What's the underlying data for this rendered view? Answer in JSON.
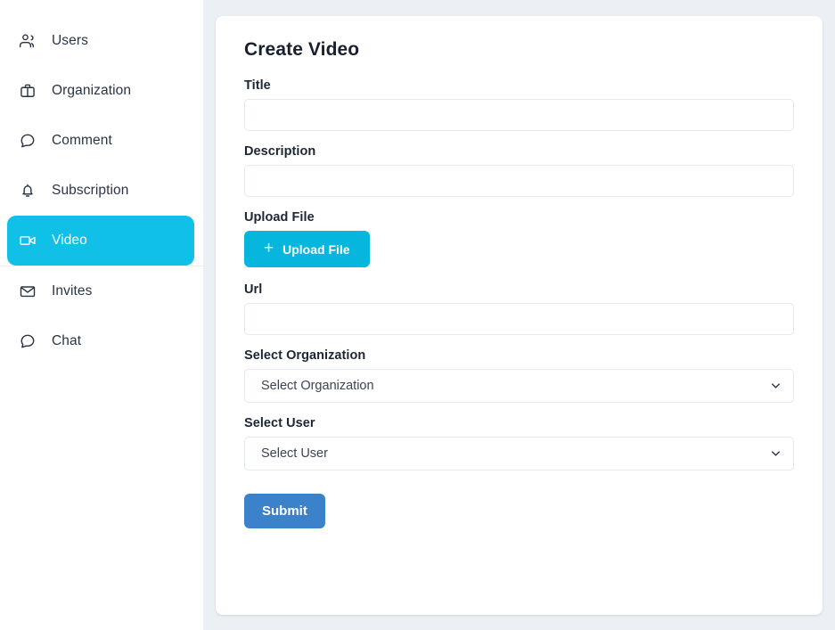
{
  "sidebar": {
    "items": [
      {
        "label": "Users",
        "icon": "users-icon",
        "active": false
      },
      {
        "label": "Organization",
        "icon": "briefcase-icon",
        "active": false
      },
      {
        "label": "Comment",
        "icon": "comment-icon",
        "active": false
      },
      {
        "label": "Subscription",
        "icon": "bell-icon",
        "active": false
      },
      {
        "label": "Video",
        "icon": "video-camera-icon",
        "active": true
      },
      {
        "label": "Invites",
        "icon": "envelope-icon",
        "active": false
      },
      {
        "label": "Chat",
        "icon": "comment-icon",
        "active": false
      }
    ]
  },
  "main": {
    "card_title": "Create Video",
    "fields": {
      "title": {
        "label": "Title",
        "value": "",
        "placeholder": ""
      },
      "description": {
        "label": "Description",
        "value": "",
        "placeholder": ""
      },
      "upload": {
        "label": "Upload File",
        "button_label": "Upload File",
        "plus": "+"
      },
      "url": {
        "label": "Url",
        "value": "",
        "placeholder": ""
      },
      "organization": {
        "label": "Select Organization",
        "selected": "Select Organization"
      },
      "user": {
        "label": "Select User",
        "selected": "Select User"
      }
    },
    "submit_label": "Submit"
  },
  "colors": {
    "accent_cyan": "#10c0e7",
    "upload_cyan": "#06b6dc",
    "submit_blue": "#3c82ca",
    "page_bg": "#eceff3",
    "card_bg": "#ffffff",
    "text_dark": "#1d2635",
    "border": "#e4e9f0"
  }
}
